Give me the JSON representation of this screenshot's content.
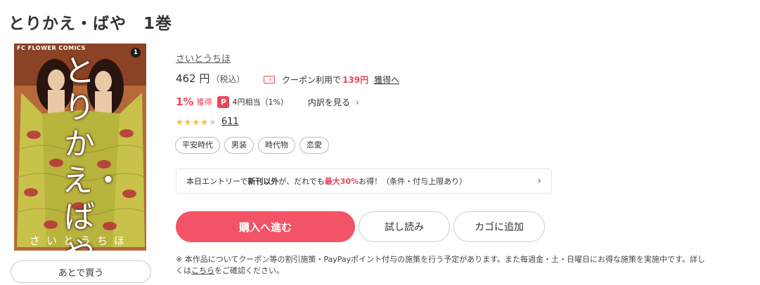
{
  "title": "とりかえ・ばや　1巻",
  "cover": {
    "brand": "FC FLOWER COMICS",
    "volume": "1",
    "title_text": "とりかえ・ばや",
    "author_text": "さいとうちほ",
    "colors": {
      "background": "#b5693a",
      "robe": "#c8c24a",
      "robe_pattern": "#b7313a"
    }
  },
  "later_button": "あとで買う",
  "author": "さいとうちほ",
  "price": {
    "amount": "462 円",
    "tax": "（税込）"
  },
  "coupon": {
    "prefix": "クーポン利用で",
    "price": "139円",
    "link": "獲得へ"
  },
  "points": {
    "percent": "1%",
    "percent_label": "獲得",
    "paypay_icon": "P",
    "paypay_text": "4円相当（1%）",
    "detail_link": "内訳を見る",
    "chevron": "›"
  },
  "rating": {
    "stars": 3.5,
    "count": "611"
  },
  "tags": [
    "平安時代",
    "男装",
    "時代物",
    "恋愛"
  ],
  "promo": {
    "part1": "本日エントリーで",
    "part2": "新刊以外",
    "part3": "が、だれでも",
    "part4": "最大30%",
    "part5": "お得！（条件・付与上限あり）",
    "chevron": "›"
  },
  "buttons": {
    "buy": "購入へ進む",
    "trial": "試し読み",
    "cart": "カゴに追加"
  },
  "note": {
    "line1": "※ 本作品についてクーポン等の割引施策・PayPayポイント付与の施策を行う予定があります。また毎週金・土・日曜日にお得な施策を実施中です。詳し",
    "line2_prefix": "くは",
    "link": "こちら",
    "line2_suffix": "をご確認ください。"
  },
  "colors": {
    "accent": "#e8475a",
    "buy_button": "#f35366",
    "star": "#f6bf26"
  }
}
